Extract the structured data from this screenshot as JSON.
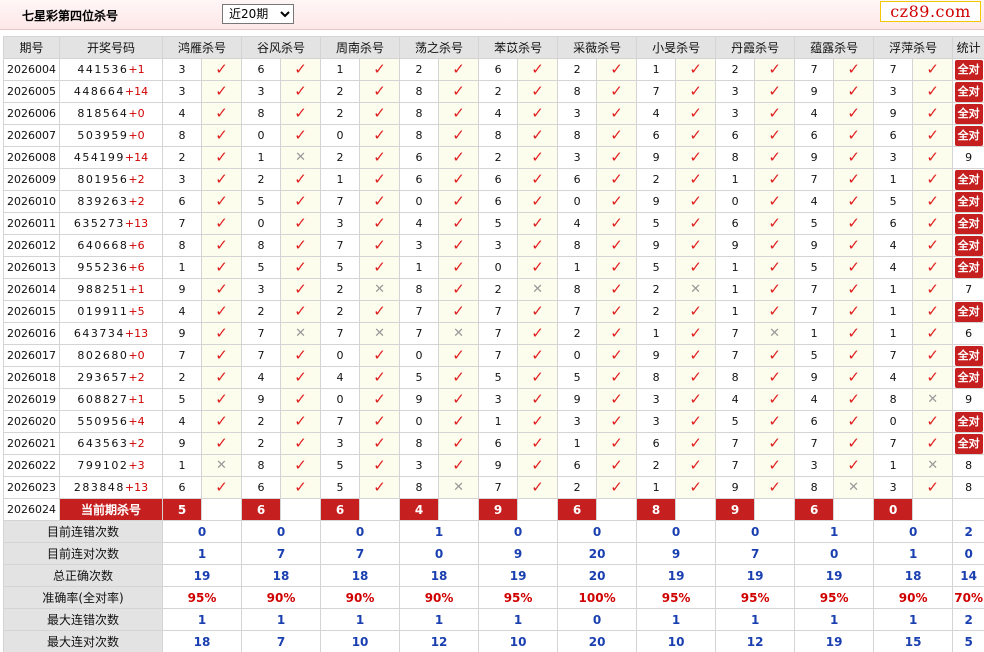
{
  "header": {
    "title": "七星彩第四位杀号",
    "range_selected": "近20期",
    "logo": "cz89.com"
  },
  "columns": {
    "period": "期号",
    "draw": "开奖号码",
    "experts": [
      "鸿雁杀号",
      "谷风杀号",
      "周南杀号",
      "荡之杀号",
      "苯苡杀号",
      "采薇杀号",
      "小旻杀号",
      "丹霞杀号",
      "蕴露杀号",
      "浮萍杀号"
    ],
    "stat": "统计"
  },
  "symbols": {
    "hit": "✓",
    "miss": "✕",
    "all_correct": "全对"
  },
  "colors": {
    "accent": "#c51f1f",
    "hit": "#e02020",
    "summary_value": "#1a3fb0"
  },
  "rows": [
    {
      "period": "2026004",
      "digits": "441536",
      "sum": "+1",
      "nums": [
        3,
        6,
        1,
        2,
        6,
        2,
        1,
        2,
        7,
        7
      ],
      "hits": [
        1,
        1,
        1,
        1,
        1,
        1,
        1,
        1,
        1,
        1
      ],
      "stat": "全对"
    },
    {
      "period": "2026005",
      "digits": "448664",
      "sum": "+14",
      "nums": [
        3,
        3,
        2,
        8,
        2,
        8,
        7,
        3,
        9,
        3
      ],
      "hits": [
        1,
        1,
        1,
        1,
        1,
        1,
        1,
        1,
        1,
        1
      ],
      "stat": "全对"
    },
    {
      "period": "2026006",
      "digits": "818564",
      "sum": "+0",
      "nums": [
        4,
        8,
        2,
        8,
        4,
        3,
        4,
        3,
        4,
        9
      ],
      "hits": [
        1,
        1,
        1,
        1,
        1,
        1,
        1,
        1,
        1,
        1
      ],
      "stat": "全对"
    },
    {
      "period": "2026007",
      "digits": "503959",
      "sum": "+0",
      "nums": [
        8,
        0,
        0,
        8,
        8,
        8,
        6,
        6,
        6,
        6
      ],
      "hits": [
        1,
        1,
        1,
        1,
        1,
        1,
        1,
        1,
        1,
        1
      ],
      "stat": "全对"
    },
    {
      "period": "2026008",
      "digits": "454199",
      "sum": "+14",
      "nums": [
        2,
        1,
        2,
        6,
        2,
        3,
        9,
        8,
        9,
        3
      ],
      "hits": [
        1,
        0,
        1,
        1,
        1,
        1,
        1,
        1,
        1,
        1
      ],
      "stat": "9"
    },
    {
      "period": "2026009",
      "digits": "801956",
      "sum": "+2",
      "nums": [
        3,
        2,
        1,
        6,
        6,
        6,
        2,
        1,
        7,
        1
      ],
      "hits": [
        1,
        1,
        1,
        1,
        1,
        1,
        1,
        1,
        1,
        1
      ],
      "stat": "全对"
    },
    {
      "period": "2026010",
      "digits": "839263",
      "sum": "+2",
      "nums": [
        6,
        5,
        7,
        0,
        6,
        0,
        9,
        0,
        4,
        5
      ],
      "hits": [
        1,
        1,
        1,
        1,
        1,
        1,
        1,
        1,
        1,
        1
      ],
      "stat": "全对"
    },
    {
      "period": "2026011",
      "digits": "635273",
      "sum": "+13",
      "nums": [
        7,
        0,
        3,
        4,
        5,
        4,
        5,
        6,
        5,
        6
      ],
      "hits": [
        1,
        1,
        1,
        1,
        1,
        1,
        1,
        1,
        1,
        1
      ],
      "stat": "全对"
    },
    {
      "period": "2026012",
      "digits": "640668",
      "sum": "+6",
      "nums": [
        8,
        8,
        7,
        3,
        3,
        8,
        9,
        9,
        9,
        4
      ],
      "hits": [
        1,
        1,
        1,
        1,
        1,
        1,
        1,
        1,
        1,
        1
      ],
      "stat": "全对"
    },
    {
      "period": "2026013",
      "digits": "955236",
      "sum": "+6",
      "nums": [
        1,
        5,
        5,
        1,
        0,
        1,
        5,
        1,
        5,
        4
      ],
      "hits": [
        1,
        1,
        1,
        1,
        1,
        1,
        1,
        1,
        1,
        1
      ],
      "stat": "全对"
    },
    {
      "period": "2026014",
      "digits": "988251",
      "sum": "+1",
      "nums": [
        9,
        3,
        2,
        8,
        2,
        8,
        2,
        1,
        7,
        1
      ],
      "hits": [
        1,
        1,
        0,
        1,
        0,
        1,
        0,
        1,
        1,
        1
      ],
      "stat": "7"
    },
    {
      "period": "2026015",
      "digits": "019911",
      "sum": "+5",
      "nums": [
        4,
        2,
        2,
        7,
        7,
        7,
        2,
        1,
        7,
        1
      ],
      "hits": [
        1,
        1,
        1,
        1,
        1,
        1,
        1,
        1,
        1,
        1
      ],
      "stat": "全对"
    },
    {
      "period": "2026016",
      "digits": "643734",
      "sum": "+13",
      "nums": [
        9,
        7,
        7,
        7,
        7,
        2,
        1,
        7,
        1,
        1
      ],
      "hits": [
        1,
        0,
        0,
        0,
        1,
        1,
        1,
        0,
        1,
        1
      ],
      "stat": "6"
    },
    {
      "period": "2026017",
      "digits": "802680",
      "sum": "+0",
      "nums": [
        7,
        7,
        0,
        0,
        7,
        0,
        9,
        7,
        5,
        7
      ],
      "hits": [
        1,
        1,
        1,
        1,
        1,
        1,
        1,
        1,
        1,
        1
      ],
      "stat": "全对"
    },
    {
      "period": "2026018",
      "digits": "293657",
      "sum": "+2",
      "nums": [
        2,
        4,
        4,
        5,
        5,
        5,
        8,
        8,
        9,
        4
      ],
      "hits": [
        1,
        1,
        1,
        1,
        1,
        1,
        1,
        1,
        1,
        1
      ],
      "stat": "全对"
    },
    {
      "period": "2026019",
      "digits": "608827",
      "sum": "+1",
      "nums": [
        5,
        9,
        0,
        9,
        3,
        9,
        3,
        4,
        4,
        8
      ],
      "hits": [
        1,
        1,
        1,
        1,
        1,
        1,
        1,
        1,
        1,
        0
      ],
      "stat": "9"
    },
    {
      "period": "2026020",
      "digits": "550956",
      "sum": "+4",
      "nums": [
        4,
        2,
        7,
        0,
        1,
        3,
        3,
        5,
        6,
        0
      ],
      "hits": [
        1,
        1,
        1,
        1,
        1,
        1,
        1,
        1,
        1,
        1
      ],
      "stat": "全对"
    },
    {
      "period": "2026021",
      "digits": "643563",
      "sum": "+2",
      "nums": [
        9,
        2,
        3,
        8,
        6,
        1,
        6,
        7,
        7,
        7
      ],
      "hits": [
        1,
        1,
        1,
        1,
        1,
        1,
        1,
        1,
        1,
        1
      ],
      "stat": "全对"
    },
    {
      "period": "2026022",
      "digits": "799102",
      "sum": "+3",
      "nums": [
        1,
        8,
        5,
        3,
        9,
        6,
        2,
        7,
        3,
        1
      ],
      "hits": [
        0,
        1,
        1,
        1,
        1,
        1,
        1,
        1,
        1,
        0
      ],
      "stat": "8"
    },
    {
      "period": "2026023",
      "digits": "283848",
      "sum": "+13",
      "nums": [
        6,
        6,
        5,
        8,
        7,
        2,
        1,
        9,
        8,
        3
      ],
      "hits": [
        1,
        1,
        1,
        0,
        1,
        1,
        1,
        1,
        0,
        1
      ],
      "stat": "8"
    }
  ],
  "current": {
    "period": "2026024",
    "label": "当前期杀号",
    "nums": [
      5,
      6,
      6,
      4,
      9,
      6,
      8,
      9,
      6,
      0
    ]
  },
  "summary": [
    {
      "label": "目前连错次数",
      "values": [
        "0",
        "0",
        "0",
        "1",
        "0",
        "0",
        "0",
        "0",
        "1",
        "0"
      ],
      "stat": "2",
      "red": false
    },
    {
      "label": "目前连对次数",
      "values": [
        "1",
        "7",
        "7",
        "0",
        "9",
        "20",
        "9",
        "7",
        "0",
        "1"
      ],
      "stat": "0",
      "red": false
    },
    {
      "label": "总正确次数",
      "values": [
        "19",
        "18",
        "18",
        "18",
        "19",
        "20",
        "19",
        "19",
        "19",
        "18"
      ],
      "stat": "14",
      "red": false
    },
    {
      "label": "准确率(全对率)",
      "values": [
        "95%",
        "90%",
        "90%",
        "90%",
        "95%",
        "100%",
        "95%",
        "95%",
        "95%",
        "90%"
      ],
      "stat": "70%",
      "red": true
    },
    {
      "label": "最大连错次数",
      "values": [
        "1",
        "1",
        "1",
        "1",
        "1",
        "0",
        "1",
        "1",
        "1",
        "1"
      ],
      "stat": "2",
      "red": false
    },
    {
      "label": "最大连对次数",
      "values": [
        "18",
        "7",
        "10",
        "12",
        "10",
        "20",
        "10",
        "12",
        "19",
        "15"
      ],
      "stat": "5",
      "red": false
    }
  ]
}
